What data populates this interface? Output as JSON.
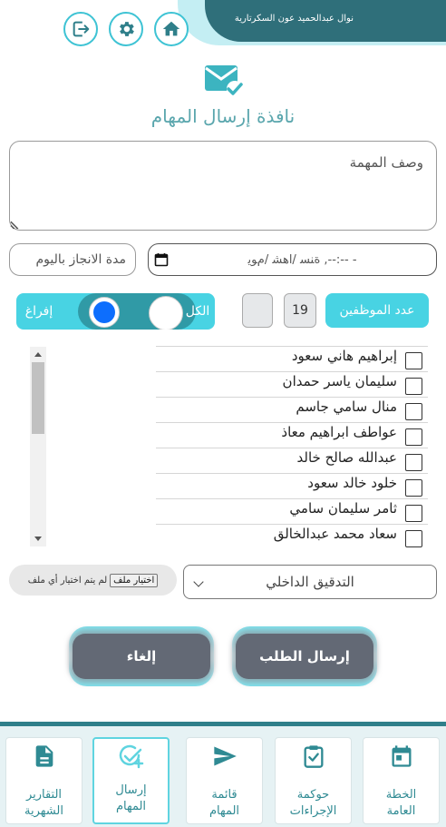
{
  "header": {
    "user_name": "نوال عبدالحميد عون  السكرتارية",
    "icons": [
      "logout-icon",
      "gear-icon",
      "home-icon"
    ]
  },
  "page": {
    "title": "نافذة إرسال المهام",
    "icon": "mail-check-icon"
  },
  "form": {
    "description_placeholder": "وصف المهمة",
    "duration_placeholder": "مدة الانجاز باليوم",
    "date_placeholder": "ﺓﻨﺴ /ﺍﻫﺸ /ﻡﻮﻳ ,--:-- -",
    "employees_count_label": "عدد الموظفين",
    "employees_count": "19",
    "toggle_all_label": "الكل",
    "toggle_clear_label": "إفراغ",
    "employees": [
      "إبراهيم هاني سعود",
      "سليمان ياسر حمدان",
      "منال سامي جاسم",
      "عواطف ابراهيم معاذ",
      "عبدالله صالح خالد",
      "خلود خالد سعود",
      "ثامر سليمان سامي",
      "سعاد محمد عبدالخالق"
    ],
    "file_button_label": "اختيار ملف",
    "file_status": "لم يتم اختيار أي ملف",
    "department_selected": "التدقيق الداخلي"
  },
  "actions": {
    "send_label": "إرسال الطلب",
    "cancel_label": "إلغاء"
  },
  "colors": {
    "header_band": "#2f6f7a",
    "accent_cyan": "#48d3e3",
    "toggle_track": "#309aa6",
    "title_teal": "#5aa6ad",
    "button_gray": "#636975",
    "nav_label": "#2f8a93"
  },
  "bottom_nav": [
    {
      "label_line1": "التقارير",
      "label_line2": "الشهرية",
      "icon": "document-icon",
      "active": false
    },
    {
      "label_line1": "إرسال",
      "label_line2": "المهام",
      "icon": "task-add-icon",
      "active": true
    },
    {
      "label_line1": "قائمة",
      "label_line2": "المهام",
      "icon": "send-icon",
      "active": false
    },
    {
      "label_line1": "حوكمة",
      "label_line2": "الإجراءات",
      "icon": "clipboard-check-icon",
      "active": false
    },
    {
      "label_line1": "الخطة",
      "label_line2": "العامة",
      "icon": "calendar-icon",
      "active": false
    }
  ]
}
